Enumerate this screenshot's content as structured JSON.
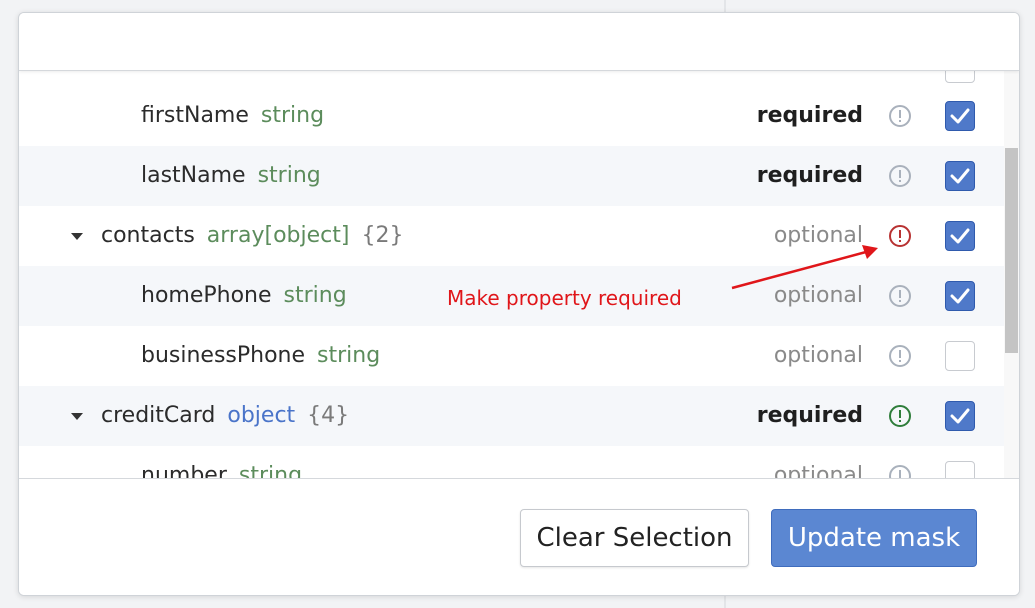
{
  "actions": {
    "clear_label": "Clear Selection",
    "update_label": "Update mask"
  },
  "annotation": "Make property required",
  "colors": {
    "accent": "#4f79c9",
    "type_string": "#5c8c5c",
    "type_object": "#4a74c9",
    "alert_neutral": "#a9b1bc",
    "alert_red": "#b83232",
    "alert_green": "#2e7d3a",
    "annotation": "#e0161a"
  },
  "properties": [
    {
      "name": "firstName",
      "type": "string",
      "count": "",
      "status": "required",
      "alert": "neutral",
      "checked": true
    },
    {
      "name": "lastName",
      "type": "string",
      "count": "",
      "status": "required",
      "alert": "neutral",
      "checked": true
    },
    {
      "name": "contacts",
      "type": "array[object]",
      "count": "{2}",
      "status": "optional",
      "alert": "red",
      "checked": true
    },
    {
      "name": "homePhone",
      "type": "string",
      "count": "",
      "status": "optional",
      "alert": "neutral",
      "checked": true
    },
    {
      "name": "businessPhone",
      "type": "string",
      "count": "",
      "status": "optional",
      "alert": "neutral",
      "checked": false
    },
    {
      "name": "creditCard",
      "type": "object",
      "count": "{4}",
      "status": "required",
      "alert": "green",
      "checked": true
    },
    {
      "name": "number",
      "type": "string",
      "count": "",
      "status": "optional",
      "alert": "neutral",
      "checked": false
    }
  ]
}
